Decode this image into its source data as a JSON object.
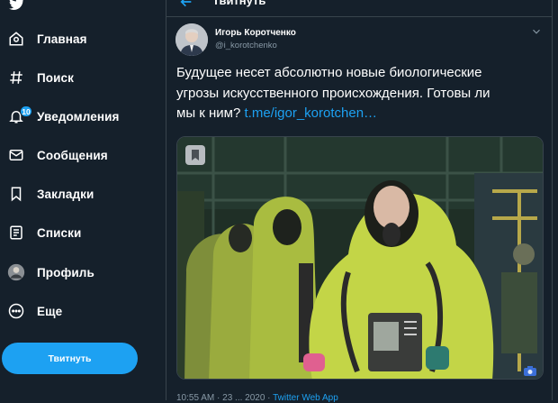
{
  "sidebar": {
    "items": [
      {
        "label": "Главная",
        "icon": "home-icon"
      },
      {
        "label": "Поиск",
        "icon": "hashtag-icon"
      },
      {
        "label": "Уведомления",
        "icon": "bell-icon",
        "badge": "10"
      },
      {
        "label": "Сообщения",
        "icon": "envelope-icon"
      },
      {
        "label": "Закладки",
        "icon": "bookmark-icon"
      },
      {
        "label": "Списки",
        "icon": "list-icon"
      },
      {
        "label": "Профиль",
        "icon": "avatar-icon"
      },
      {
        "label": "Еще",
        "icon": "more-icon"
      }
    ],
    "tweet_button": "Твитнуть"
  },
  "header": {
    "title": "Твитнуть"
  },
  "tweet": {
    "author_name": "Игорь Коротченко",
    "author_handle": "@i_korotchenko",
    "text_line1": "Будущее несет абсолютно новые биологические",
    "text_line2": "угрозы искусственного происхождения. Готовы ли",
    "text_line3": "мы к ним?",
    "link": "t.me/igor_korotchen…",
    "media_description": "people in yellow hazmat suits",
    "meta_time": "10:55 AM · 23 ... 2020 ·",
    "meta_source": "Twitter Web App"
  },
  "colors": {
    "background": "#15202b",
    "accent": "#1da1f2",
    "border": "#38444d",
    "secondary_text": "#8899a6"
  }
}
